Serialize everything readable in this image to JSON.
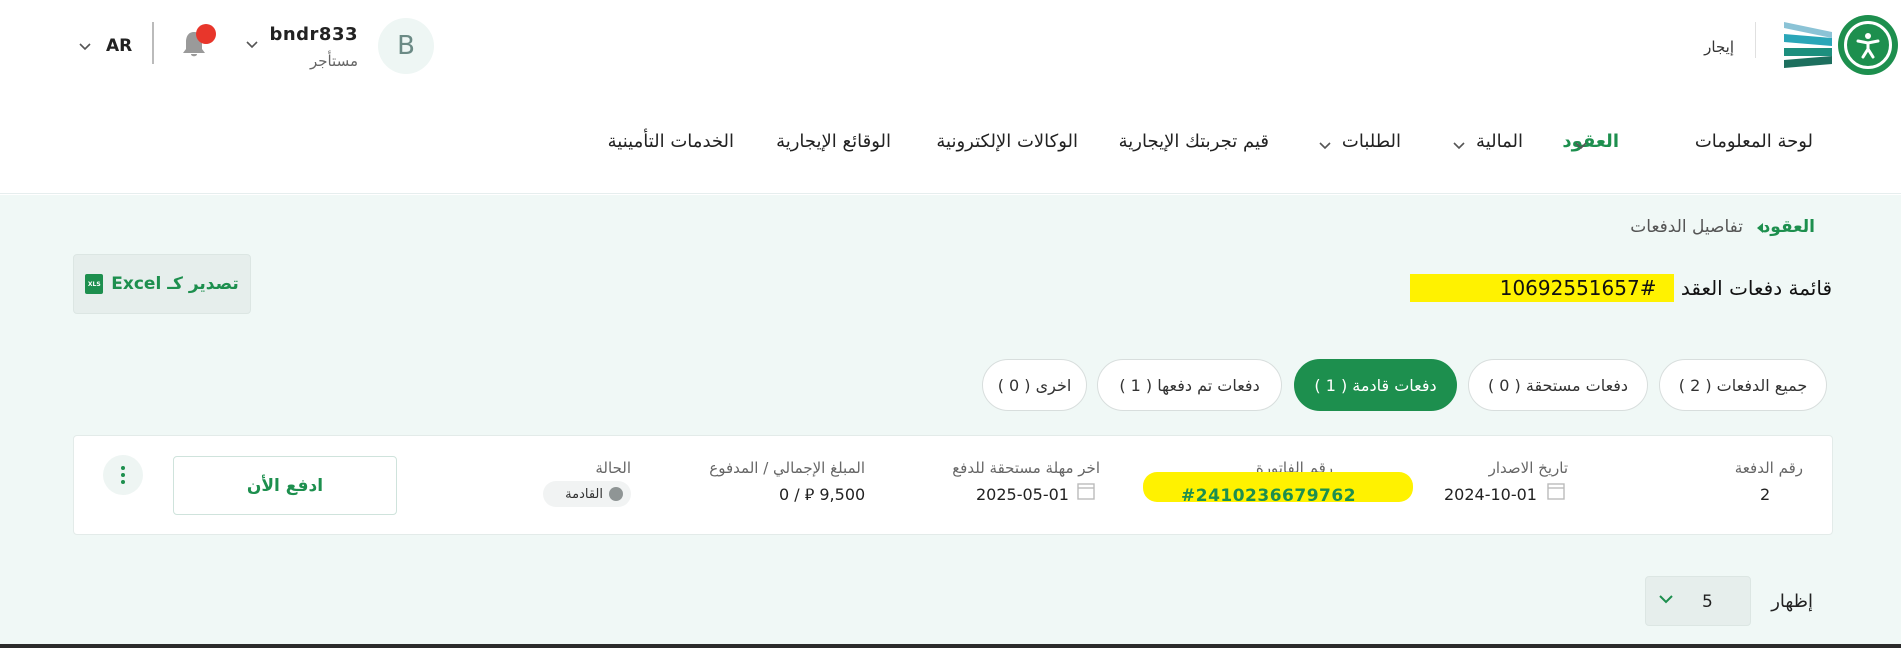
{
  "header": {
    "brand_text": "إيجار",
    "user": {
      "initial": "B",
      "name": "bndr833",
      "role": "مستأجر"
    },
    "language": "AR"
  },
  "nav": {
    "items": [
      {
        "label": "لوحة المعلومات",
        "has_dropdown": false,
        "active": false
      },
      {
        "label": "العقود",
        "has_dropdown": true,
        "active": true
      },
      {
        "label": "المالية",
        "has_dropdown": true,
        "active": false
      },
      {
        "label": "الطلبات",
        "has_dropdown": true,
        "active": false
      },
      {
        "label": "قيم تجربتك الإيجارية",
        "has_dropdown": false,
        "active": false
      },
      {
        "label": "الوكالات الإلكترونية",
        "has_dropdown": false,
        "active": false
      },
      {
        "label": "الوقائع الإيجارية",
        "has_dropdown": false,
        "active": false
      },
      {
        "label": "الخدمات التأمينية",
        "has_dropdown": false,
        "active": false
      }
    ]
  },
  "breadcrumb": {
    "parent": "العقود",
    "current": "تفاصيل الدفعات"
  },
  "page": {
    "title_prefix": "قائمة دفعات العقد",
    "contract_number": "#10692551657",
    "export_label": "تصدير كـ Excel",
    "xls_badge": "XLS"
  },
  "tabs": [
    {
      "label": "جميع الدفعات ( 2 )",
      "active": false
    },
    {
      "label": "دفعات مستحقة ( 0 )",
      "active": false
    },
    {
      "label": "دفعات قادمة ( 1 )",
      "active": true
    },
    {
      "label": "دفعات تم دفعها ( 1 )",
      "active": false
    },
    {
      "label": "اخرى ( 0 )",
      "active": false
    }
  ],
  "payment": {
    "labels": {
      "number": "رقم الدفعة",
      "issue_date": "تاريخ الاصدار",
      "invoice": "رقم الفاتورة",
      "due_date": "اخر مهلة مستحقة للدفع",
      "amount": "المبلغ الإجمالي / المدفوع",
      "status": "الحالة"
    },
    "number": "2",
    "issue_date": "2024-10-01",
    "invoice": "#2410236679762",
    "due_date": "2025-05-01",
    "amount_total": "9,500",
    "amount_paid": "0",
    "currency_symbol": "⃁",
    "status": "القادمة",
    "pay_label": "ادفع الأن"
  },
  "pagination": {
    "show_label": "إظهار",
    "page_size": "5"
  },
  "colors": {
    "primary": "#1d8f4e",
    "highlight": "#fff200",
    "background": "#f0f8f6",
    "notification": "#e8362b"
  }
}
